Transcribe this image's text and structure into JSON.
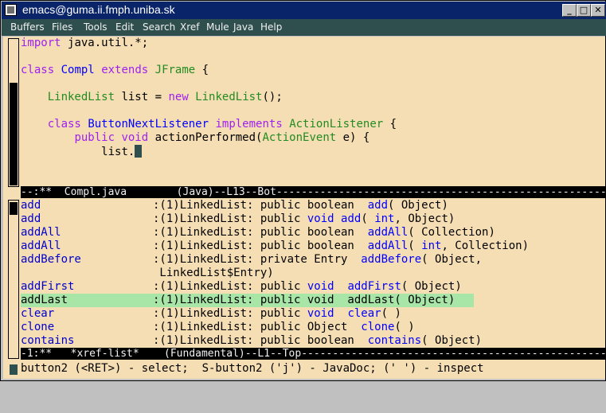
{
  "window": {
    "title": "emacs@guma.ii.fmph.uniba.sk",
    "buttons": {
      "minimize": "_",
      "maximize": "□",
      "close": "✕"
    }
  },
  "menubar": {
    "items": [
      "Buffers",
      "Files",
      "Tools",
      "Edit",
      "Search",
      "Xref",
      "Mule",
      "Java",
      "Help"
    ]
  },
  "code_buffer": {
    "lines": [
      {
        "parts": [
          [
            "k",
            "import"
          ],
          [
            "",
            "java.util.*;"
          ]
        ],
        "join": [
          " "
        ]
      },
      {
        "parts": []
      },
      {
        "parts": [
          [
            "k",
            "class"
          ],
          [
            "",
            "Compl"
          ],
          [
            "k",
            "extends"
          ],
          [
            "t",
            "JFrame"
          ],
          [
            "",
            "{"
          ]
        ]
      },
      {
        "parts": []
      },
      {
        "parts": [
          [
            "t",
            "LinkedList"
          ],
          [
            "",
            "list ="
          ],
          [
            "k",
            "new"
          ],
          [
            "t",
            "LinkedList"
          ],
          [
            "",
            "();"
          ]
        ]
      },
      {
        "parts": []
      },
      {
        "parts": [
          [
            "k",
            "class"
          ],
          [
            "t",
            "ButtonNextListener"
          ],
          [
            "k",
            "implements"
          ],
          [
            "t",
            "ActionListener"
          ],
          [
            "",
            "{"
          ]
        ]
      },
      {
        "parts": [
          [
            "k",
            "public"
          ],
          [
            "k",
            "void"
          ],
          [
            "",
            "actionPerformed("
          ],
          [
            "t",
            "ActionEvent"
          ],
          [
            "",
            "e) {"
          ]
        ]
      },
      {
        "parts": [
          [
            "",
            "list."
          ]
        ]
      }
    ],
    "modeline": "--:**  Compl.java        (Java)--L13--Bot-------------------------------------------------------"
  },
  "xref_buffer": {
    "rows": [
      {
        "name": "add",
        "prefix": ":(1)LinkedList: public boolean  ",
        "sig": [
          [
            "f",
            "add"
          ],
          [
            "",
            "( Object)"
          ]
        ]
      },
      {
        "name": "add",
        "prefix": ":(1)LinkedList: public ",
        "sig": [
          [
            "v",
            "void"
          ],
          [
            "",
            " "
          ],
          [
            "f",
            "add"
          ],
          [
            "",
            "( "
          ],
          [
            "v",
            "int"
          ],
          [
            "",
            ", Object)"
          ]
        ]
      },
      {
        "name": "addAll",
        "prefix": ":(1)LinkedList: public boolean  ",
        "sig": [
          [
            "f",
            "addAll"
          ],
          [
            "",
            "( Collection)"
          ]
        ]
      },
      {
        "name": "addAll",
        "prefix": ":(1)LinkedList: public boolean  ",
        "sig": [
          [
            "f",
            "addAll"
          ],
          [
            "",
            "( "
          ],
          [
            "v",
            "int"
          ],
          [
            "",
            ", Collection)"
          ]
        ]
      },
      {
        "name": "addBefore",
        "prefix": ":(1)LinkedList: private Entry  ",
        "sig": [
          [
            "f",
            "addBefore"
          ],
          [
            "",
            "( Object,"
          ]
        ]
      },
      {
        "name": "",
        "prefix": " LinkedList$Entry)",
        "sig": []
      },
      {
        "name": "addFirst",
        "prefix": ":(1)LinkedList: public ",
        "sig": [
          [
            "v",
            "void"
          ],
          [
            "",
            "  "
          ],
          [
            "f",
            "addFirst"
          ],
          [
            "",
            "( Object)"
          ]
        ]
      },
      {
        "name": "addLast",
        "prefix": ":(1)LinkedList: public void  addLast( Object)",
        "sig": [],
        "highlight": true
      },
      {
        "name": "clear",
        "prefix": ":(1)LinkedList: public ",
        "sig": [
          [
            "v",
            "void"
          ],
          [
            "",
            "  "
          ],
          [
            "f",
            "clear"
          ],
          [
            "",
            "( )"
          ]
        ]
      },
      {
        "name": "clone",
        "prefix": ":(1)LinkedList: public Object  ",
        "sig": [
          [
            "f",
            "clone"
          ],
          [
            "",
            "( )"
          ]
        ]
      },
      {
        "name": "contains",
        "prefix": ":(1)LinkedList: public boolean  ",
        "sig": [
          [
            "f",
            "contains"
          ],
          [
            "",
            "( Object)"
          ]
        ]
      }
    ],
    "modeline": "-1:**   *xref-list*    (Fundamental)--L1--Top-------------------------------------------------"
  },
  "echo_area": {
    "text": "button2 (<RET>) - select;  S-button2 ('j') - JavaDoc; (' ') - inspect"
  }
}
